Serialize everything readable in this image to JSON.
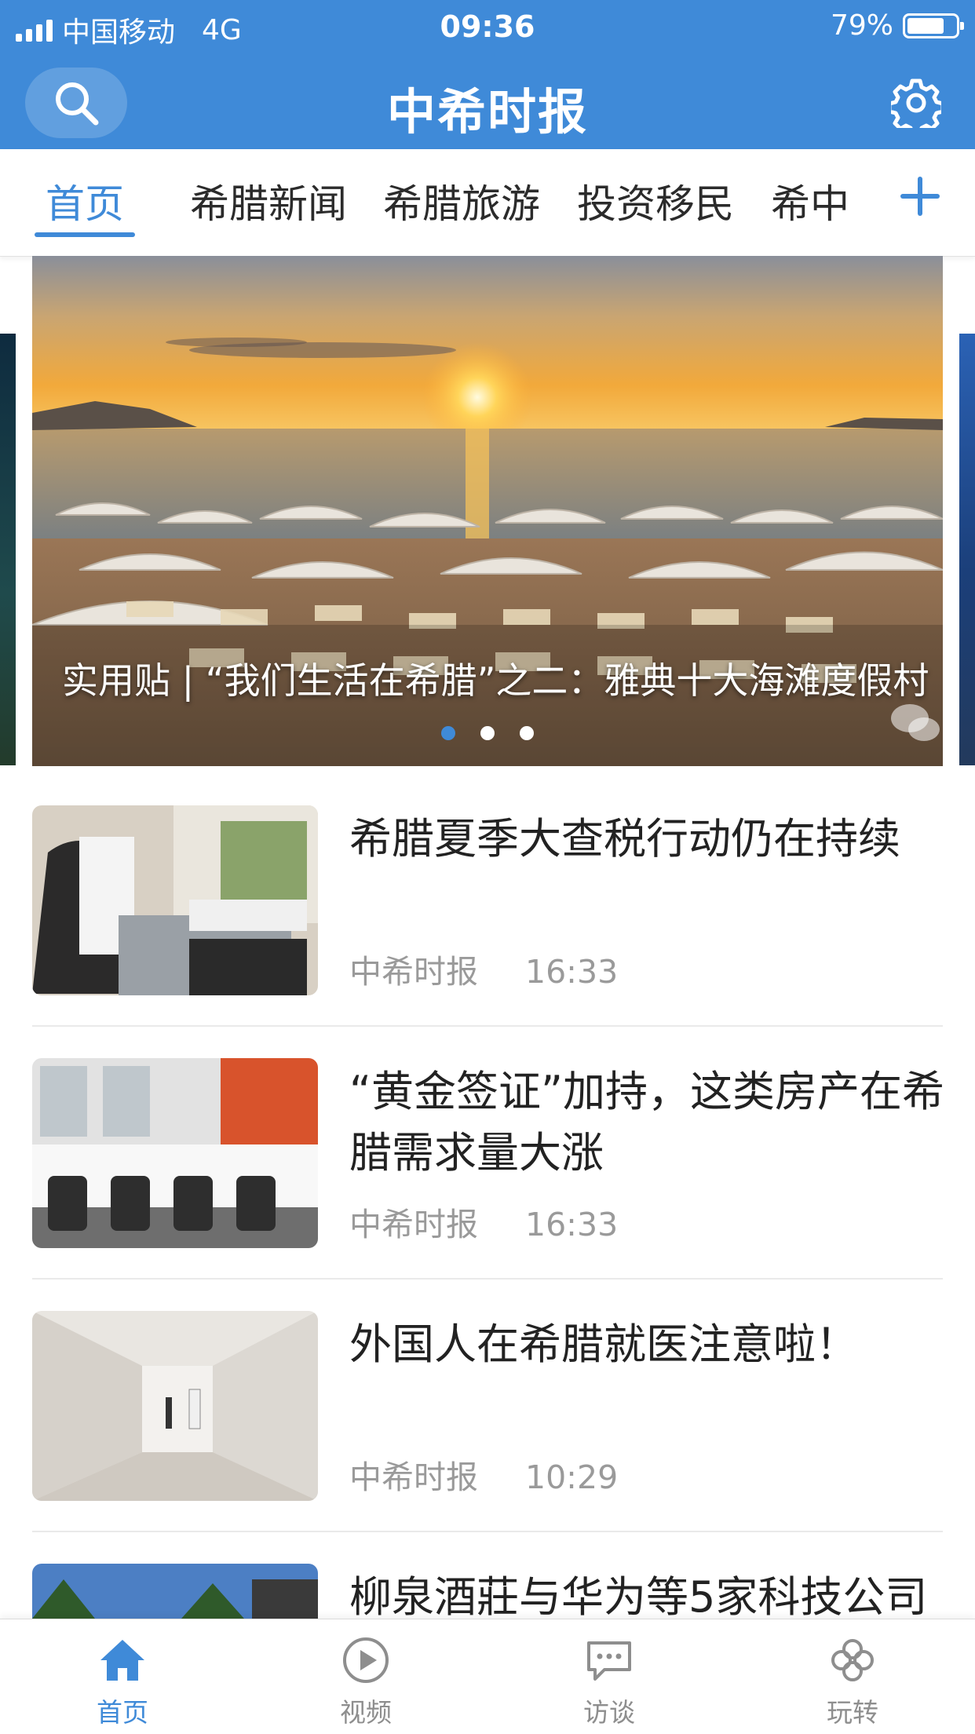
{
  "status_bar": {
    "carrier": "中国移动",
    "network": "4G",
    "time": "09:36",
    "battery": "79%",
    "battery_level": 0.79
  },
  "app_bar": {
    "title": "中希时报",
    "search_icon": "search-icon",
    "settings_icon": "gear-icon"
  },
  "tabs": {
    "items": [
      {
        "label": "首页",
        "active": true
      },
      {
        "label": "希腊新闻",
        "active": false
      },
      {
        "label": "希腊旅游",
        "active": false
      },
      {
        "label": "投资移民",
        "active": false
      },
      {
        "label": "希中",
        "active": false
      }
    ],
    "add_icon": "plus-icon"
  },
  "banner": {
    "caption": "实用贴 | “我们生活在希腊”之二：雅典十大海滩度假村",
    "slide_count": 3,
    "active_slide": 1
  },
  "news": [
    {
      "title": "希腊夏季大查税行动仍在持续",
      "source": "中希时报",
      "time": "16:33"
    },
    {
      "title": "“黄金签证”加持，这类房产在希腊需求量大涨",
      "source": "中希时报",
      "time": "16:33"
    },
    {
      "title": "外国人在希腊就医注意啦！",
      "source": "中希时报",
      "time": "10:29"
    },
    {
      "title": "柳泉酒莊与华为等5家科技公司"
    }
  ],
  "bottom_nav": [
    {
      "label": "首页",
      "icon": "home-icon",
      "active": true
    },
    {
      "label": "视频",
      "icon": "play-icon",
      "active": false
    },
    {
      "label": "访谈",
      "icon": "chat-icon",
      "active": false
    },
    {
      "label": "玩转",
      "icon": "clover-icon",
      "active": false
    }
  ],
  "colors": {
    "accent": "#3f8ad8",
    "text": "#222222",
    "meta": "#9a9a9a"
  }
}
